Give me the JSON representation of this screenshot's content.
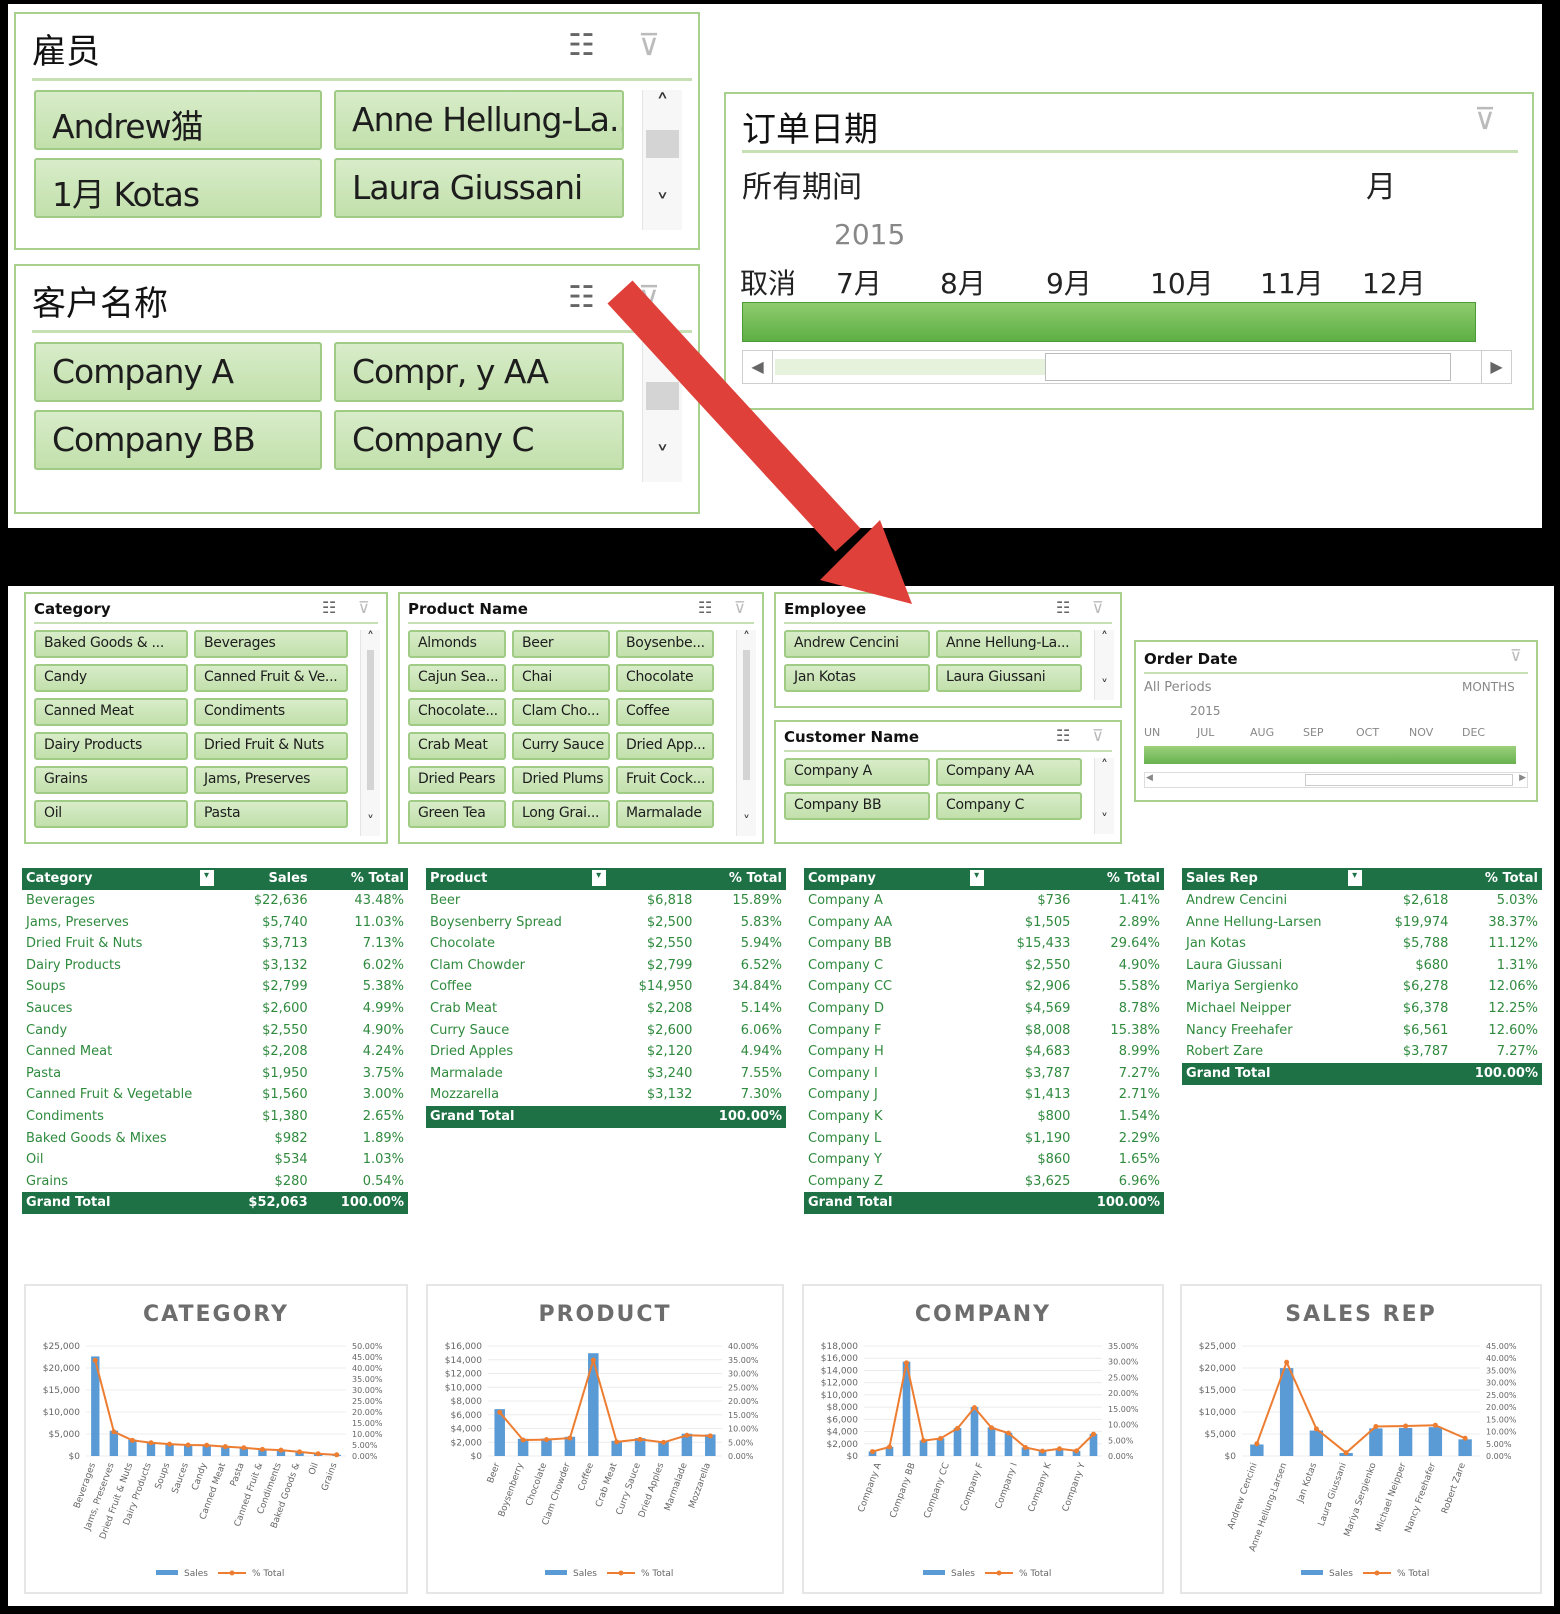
{
  "top_slicers": {
    "employee": {
      "title": "雇员",
      "items": [
        "Andrew猫",
        "Anne Hellung-La...",
        "1月 Kotas",
        "Laura Giussani"
      ]
    },
    "customer": {
      "title": "客户名称",
      "items": [
        "Company A",
        "Compr, y AA",
        "Company BB",
        "Company C"
      ]
    },
    "order_date": {
      "title": "订单日期",
      "all_periods": "所有期间",
      "level": "月",
      "year": "2015",
      "cancel": "取消",
      "months": [
        "7月",
        "8月",
        "9月",
        "10月",
        "11月",
        "12月"
      ]
    }
  },
  "slicers": {
    "category": {
      "title": "Category",
      "items": [
        "Baked Goods & ...",
        "Beverages",
        "Candy",
        "Canned Fruit & Ve...",
        "Canned Meat",
        "Condiments",
        "Dairy Products",
        "Dried Fruit & Nuts",
        "Grains",
        "Jams, Preserves",
        "Oil",
        "Pasta"
      ]
    },
    "product": {
      "title": "Product Name",
      "items": [
        "Almonds",
        "Beer",
        "Boysenbe...",
        "Cajun Sea...",
        "Chai",
        "Chocolate",
        "Chocolate...",
        "Clam Cho...",
        "Coffee",
        "Crab Meat",
        "Curry Sauce",
        "Dried App...",
        "Dried Pears",
        "Dried Plums",
        "Fruit Cock...",
        "Green Tea",
        "Long Grai...",
        "Marmalade"
      ]
    },
    "employee": {
      "title": "Employee",
      "items": [
        "Andrew Cencini",
        "Anne Hellung-La...",
        "Jan Kotas",
        "Laura Giussani"
      ]
    },
    "customer": {
      "title": "Customer Name",
      "items": [
        "Company A",
        "Company AA",
        "Company BB",
        "Company C"
      ]
    },
    "order_date": {
      "title": "Order Date",
      "all_periods": "All Periods",
      "level": "MONTHS",
      "year": "2015",
      "months": [
        "UN",
        "JUL",
        "AUG",
        "SEP",
        "OCT",
        "NOV",
        "DEC"
      ]
    }
  },
  "pivots": [
    {
      "headers": [
        "Category",
        "Sales",
        "% Total"
      ],
      "rows": [
        [
          "Beverages",
          "$22,636",
          "43.48%"
        ],
        [
          "Jams, Preserves",
          "$5,740",
          "11.03%"
        ],
        [
          "Dried Fruit & Nuts",
          "$3,713",
          "7.13%"
        ],
        [
          "Dairy Products",
          "$3,132",
          "6.02%"
        ],
        [
          "Soups",
          "$2,799",
          "5.38%"
        ],
        [
          "Sauces",
          "$2,600",
          "4.99%"
        ],
        [
          "Candy",
          "$2,550",
          "4.90%"
        ],
        [
          "Canned Meat",
          "$2,208",
          "4.24%"
        ],
        [
          "Pasta",
          "$1,950",
          "3.75%"
        ],
        [
          "Canned Fruit & Vegetable",
          "$1,560",
          "3.00%"
        ],
        [
          "Condiments",
          "$1,380",
          "2.65%"
        ],
        [
          "Baked Goods & Mixes",
          "$982",
          "1.89%"
        ],
        [
          "Oil",
          "$534",
          "1.03%"
        ],
        [
          "Grains",
          "$280",
          "0.54%"
        ]
      ],
      "total": [
        "Grand Total",
        "$52,063",
        "100.00%"
      ]
    },
    {
      "headers": [
        "Product",
        "",
        "% Total"
      ],
      "rows": [
        [
          "Beer",
          "$6,818",
          "15.89%"
        ],
        [
          "Boysenberry Spread",
          "$2,500",
          "5.83%"
        ],
        [
          "Chocolate",
          "$2,550",
          "5.94%"
        ],
        [
          "Clam Chowder",
          "$2,799",
          "6.52%"
        ],
        [
          "Coffee",
          "$14,950",
          "34.84%"
        ],
        [
          "Crab Meat",
          "$2,208",
          "5.14%"
        ],
        [
          "Curry Sauce",
          "$2,600",
          "6.06%"
        ],
        [
          "Dried Apples",
          "$2,120",
          "4.94%"
        ],
        [
          "Marmalade",
          "$3,240",
          "7.55%"
        ],
        [
          "Mozzarella",
          "$3,132",
          "7.30%"
        ]
      ],
      "total": [
        "Grand Total",
        "",
        "100.00%"
      ]
    },
    {
      "headers": [
        "Company",
        "",
        "% Total"
      ],
      "rows": [
        [
          "Company A",
          "$736",
          "1.41%"
        ],
        [
          "Company AA",
          "$1,505",
          "2.89%"
        ],
        [
          "Company BB",
          "$15,433",
          "29.64%"
        ],
        [
          "Company C",
          "$2,550",
          "4.90%"
        ],
        [
          "Company CC",
          "$2,906",
          "5.58%"
        ],
        [
          "Company D",
          "$4,569",
          "8.78%"
        ],
        [
          "Company F",
          "$8,008",
          "15.38%"
        ],
        [
          "Company H",
          "$4,683",
          "8.99%"
        ],
        [
          "Company I",
          "$3,787",
          "7.27%"
        ],
        [
          "Company J",
          "$1,413",
          "2.71%"
        ],
        [
          "Company K",
          "$800",
          "1.54%"
        ],
        [
          "Company L",
          "$1,190",
          "2.29%"
        ],
        [
          "Company Y",
          "$860",
          "1.65%"
        ],
        [
          "Company Z",
          "$3,625",
          "6.96%"
        ]
      ],
      "total": [
        "Grand Total",
        "",
        "100.00%"
      ]
    },
    {
      "headers": [
        "Sales Rep",
        "",
        "% Total"
      ],
      "rows": [
        [
          "Andrew Cencini",
          "$2,618",
          "5.03%"
        ],
        [
          "Anne Hellung-Larsen",
          "$19,974",
          "38.37%"
        ],
        [
          "Jan Kotas",
          "$5,788",
          "11.12%"
        ],
        [
          "Laura Giussani",
          "$680",
          "1.31%"
        ],
        [
          "Mariya Sergienko",
          "$6,278",
          "12.06%"
        ],
        [
          "Michael Neipper",
          "$6,378",
          "12.25%"
        ],
        [
          "Nancy Freehafer",
          "$6,561",
          "12.60%"
        ],
        [
          "Robert Zare",
          "$3,787",
          "7.27%"
        ]
      ],
      "total": [
        "Grand Total",
        "",
        "100.00%"
      ]
    }
  ],
  "chart_data": [
    {
      "type": "bar",
      "title": "CATEGORY",
      "categories": [
        "Beverages",
        "Jams, Preserves",
        "Dried Fruit & Nuts",
        "Dairy Products",
        "Soups",
        "Sauces",
        "Candy",
        "Canned Meat",
        "Pasta",
        "Canned Fruit &",
        "Condiments",
        "Baked Goods &",
        "Oil",
        "Grains"
      ],
      "series": [
        {
          "name": "Sales",
          "type": "bar",
          "values": [
            22636,
            5740,
            3713,
            3132,
            2799,
            2600,
            2550,
            2208,
            1950,
            1560,
            1380,
            982,
            534,
            280
          ]
        },
        {
          "name": "% Total",
          "type": "line",
          "axis": "right",
          "values": [
            43.48,
            11.03,
            7.13,
            6.02,
            5.38,
            4.99,
            4.9,
            4.24,
            3.75,
            3.0,
            2.65,
            1.89,
            1.03,
            0.54
          ]
        }
      ],
      "ylim": [
        0,
        25000
      ],
      "y_ticks": [
        "$25,000",
        "$20,000",
        "$15,000",
        "$10,000",
        "$5,000",
        "$0"
      ],
      "y2lim": [
        0,
        50
      ],
      "y2_ticks": [
        "50.00%",
        "45.00%",
        "40.00%",
        "35.00%",
        "30.00%",
        "25.00%",
        "20.00%",
        "15.00%",
        "10.00%",
        "5.00%",
        "0.00%"
      ]
    },
    {
      "type": "bar",
      "title": "PRODUCT",
      "categories": [
        "Beer",
        "Boysenberry",
        "Chocolate",
        "Clam Chowder",
        "Coffee",
        "Crab Meat",
        "Curry Sauce",
        "Dried Apples",
        "Marmalade",
        "Mozzarella"
      ],
      "series": [
        {
          "name": "Sales",
          "type": "bar",
          "values": [
            6818,
            2500,
            2550,
            2799,
            14950,
            2208,
            2600,
            2120,
            3240,
            3132
          ]
        },
        {
          "name": "% Total",
          "type": "line",
          "axis": "right",
          "values": [
            15.89,
            5.83,
            5.94,
            6.52,
            34.84,
            5.14,
            6.06,
            4.94,
            7.55,
            7.3
          ]
        }
      ],
      "ylim": [
        0,
        16000
      ],
      "y_ticks": [
        "$16,000",
        "$14,000",
        "$12,000",
        "$10,000",
        "$8,000",
        "$6,000",
        "$4,000",
        "$2,000",
        "$0"
      ],
      "y2lim": [
        0,
        40
      ],
      "y2_ticks": [
        "40.00%",
        "35.00%",
        "30.00%",
        "25.00%",
        "20.00%",
        "15.00%",
        "10.00%",
        "5.00%",
        "0.00%"
      ]
    },
    {
      "type": "bar",
      "title": "COMPANY",
      "categories": [
        "Company A",
        "Company BB",
        "Company CC",
        "Company F",
        "Company I",
        "Company K",
        "Company Y"
      ],
      "bar_labels_all": [
        "Company A",
        "Company AA",
        "Company BB",
        "Company C",
        "Company CC",
        "Company D",
        "Company F",
        "Company H",
        "Company I",
        "Company J",
        "Company K",
        "Company L",
        "Company Y",
        "Company Z"
      ],
      "series": [
        {
          "name": "Sales",
          "type": "bar",
          "values": [
            736,
            1505,
            15433,
            2550,
            2906,
            4569,
            8008,
            4683,
            3787,
            1413,
            800,
            1190,
            860,
            3625
          ]
        },
        {
          "name": "% Total",
          "type": "line",
          "axis": "right",
          "values": [
            1.41,
            2.89,
            29.64,
            4.9,
            5.58,
            8.78,
            15.38,
            8.99,
            7.27,
            2.71,
            1.54,
            2.29,
            1.65,
            6.96
          ]
        }
      ],
      "ylim": [
        0,
        18000
      ],
      "y_ticks": [
        "$18,000",
        "$16,000",
        "$14,000",
        "$12,000",
        "$10,000",
        "$8,000",
        "$6,000",
        "$4,000",
        "$2,000",
        "$0"
      ],
      "y2lim": [
        0,
        35
      ],
      "y2_ticks": [
        "35.00%",
        "30.00%",
        "25.00%",
        "20.00%",
        "15.00%",
        "10.00%",
        "5.00%",
        "0.00%"
      ]
    },
    {
      "type": "bar",
      "title": "SALES REP",
      "categories": [
        "Andrew Cencini",
        "Anne Hellung-Larsen",
        "Jan Kotas",
        "Laura Giussani",
        "Mariya Sergienko",
        "Michael Neipper",
        "Nancy Freehafer",
        "Robert Zare"
      ],
      "series": [
        {
          "name": "Sales",
          "type": "bar",
          "values": [
            2618,
            19974,
            5788,
            680,
            6278,
            6378,
            6561,
            3787
          ]
        },
        {
          "name": "% Total",
          "type": "line",
          "axis": "right",
          "values": [
            5.03,
            38.37,
            11.12,
            1.31,
            12.06,
            12.25,
            12.6,
            7.27
          ]
        }
      ],
      "ylim": [
        0,
        25000
      ],
      "y_ticks": [
        "$25,000",
        "$20,000",
        "$15,000",
        "$10,000",
        "$5,000",
        "$0"
      ],
      "y2lim": [
        0,
        45
      ],
      "y2_ticks": [
        "45.00%",
        "40.00%",
        "35.00%",
        "30.00%",
        "25.00%",
        "20.00%",
        "15.00%",
        "10.00%",
        "5.00%",
        "0.00%"
      ]
    }
  ],
  "legend": {
    "sales": "Sales",
    "pct": "% Total"
  },
  "colors": {
    "bar": "#5b9bd5",
    "line": "#ed7d31",
    "pivot_header": "#1e7145",
    "slicer_border": "#a9d18e",
    "arrow": "#e0403a"
  }
}
